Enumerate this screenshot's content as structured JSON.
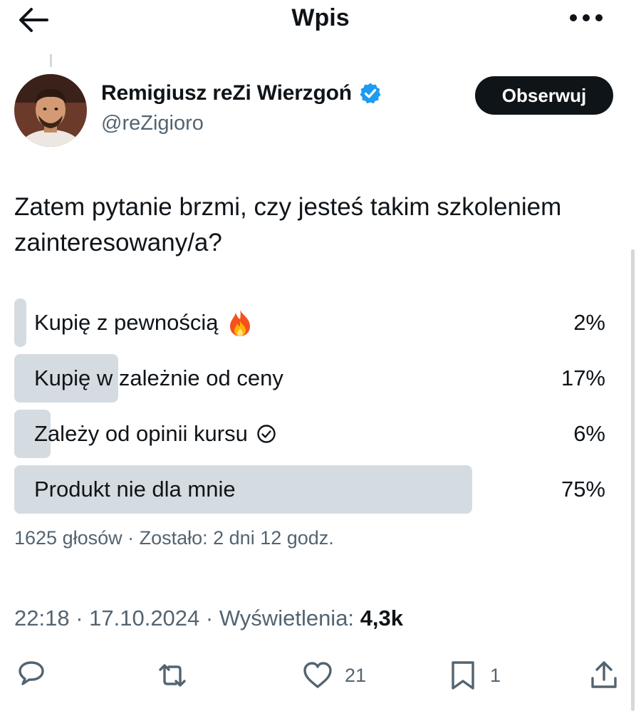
{
  "header": {
    "title": "Wpis",
    "back_icon": "arrow-left-icon",
    "more_icon": "more-horizontal-icon"
  },
  "author": {
    "name": "Remigiusz reZi Wierzgoń",
    "handle": "@reZigioro",
    "verified": true,
    "follow_label": "Obserwuj"
  },
  "tweet": {
    "text": "Zatem pytanie brzmi, czy jesteś takim szkoleniem zainteresowany/a?"
  },
  "poll": {
    "options": [
      {
        "label": "Kupię z pewnością",
        "percent": "2%",
        "value": 0.02,
        "icon": "fire-emoji-icon"
      },
      {
        "label": "Kupię w zależnie od ceny",
        "percent": "17%",
        "value": 0.17,
        "icon": ""
      },
      {
        "label": "Zależy od opinii kursu",
        "percent": "6%",
        "value": 0.06,
        "icon": "check-circle-icon"
      },
      {
        "label": "Produkt nie dla mnie",
        "percent": "75%",
        "value": 0.75,
        "icon": ""
      }
    ],
    "meta": "1625 głosów · Zostało: 2 dni 12 godz."
  },
  "tweet_meta": {
    "time_date": "22:18 · 17.10.2024 · Wyświetlenia:",
    "views": "4,3k"
  },
  "actions": {
    "reply_icon": "reply-icon",
    "retweet_icon": "retweet-icon",
    "like_icon": "heart-icon",
    "like_count": "21",
    "bookmark_icon": "bookmark-icon",
    "bookmark_count": "1",
    "share_icon": "share-icon"
  },
  "colors": {
    "text": "#0f1419",
    "muted": "#536471",
    "poll_fill": "#d5dce1",
    "verified": "#1d9bf0"
  }
}
